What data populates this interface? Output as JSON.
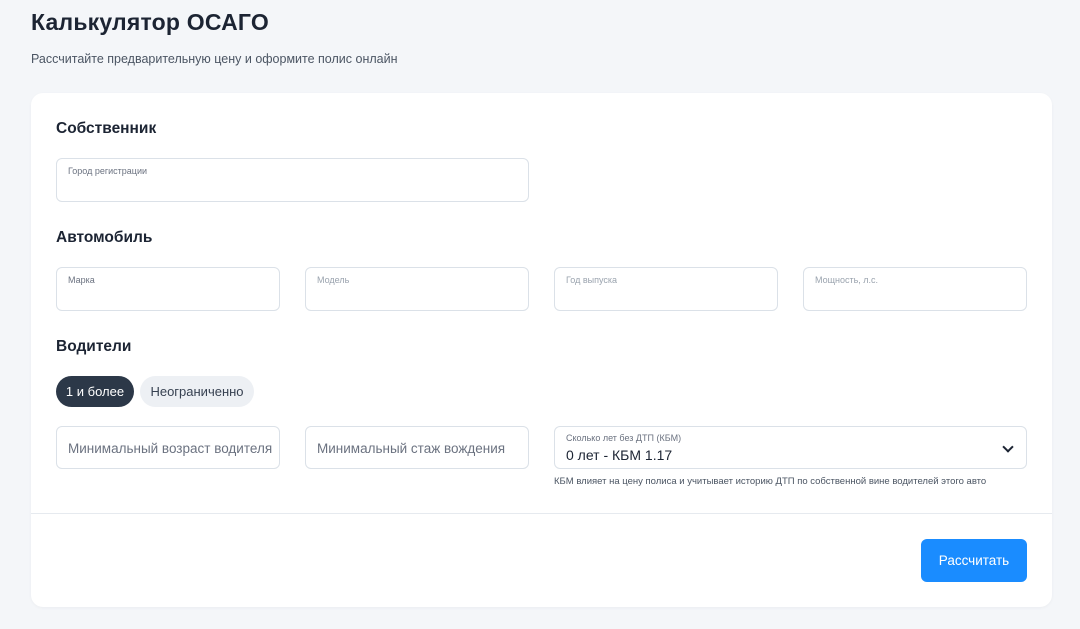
{
  "header": {
    "title": "Калькулятор ОСАГО",
    "subtitle": "Рассчитайте предварительную цену и оформите полис онлайн"
  },
  "owner": {
    "section_title": "Собственник",
    "city_label": "Город регистрации"
  },
  "car": {
    "section_title": "Автомобиль",
    "brand_label": "Марка",
    "model_label": "Модель",
    "year_label": "Год выпуска",
    "power_label": "Мощность, л.с."
  },
  "drivers": {
    "section_title": "Водители",
    "option_limited": "1 и более",
    "option_unlimited": "Неограниченно",
    "min_age_placeholder": "Минимальный возраст водителя",
    "min_experience_placeholder": "Минимальный стаж вождения",
    "kbm_label": "Сколько лет без ДТП (КБМ)",
    "kbm_value": "0 лет - КБМ 1.17",
    "kbm_hint": "КБМ влияет на цену полиса и учитывает историю ДТП по собственной вине водителей этого авто"
  },
  "actions": {
    "submit_label": "Рассчитать"
  },
  "colors": {
    "accent": "#1a8cff",
    "active_pill": "#2c3848",
    "background": "#f4f6f9"
  }
}
